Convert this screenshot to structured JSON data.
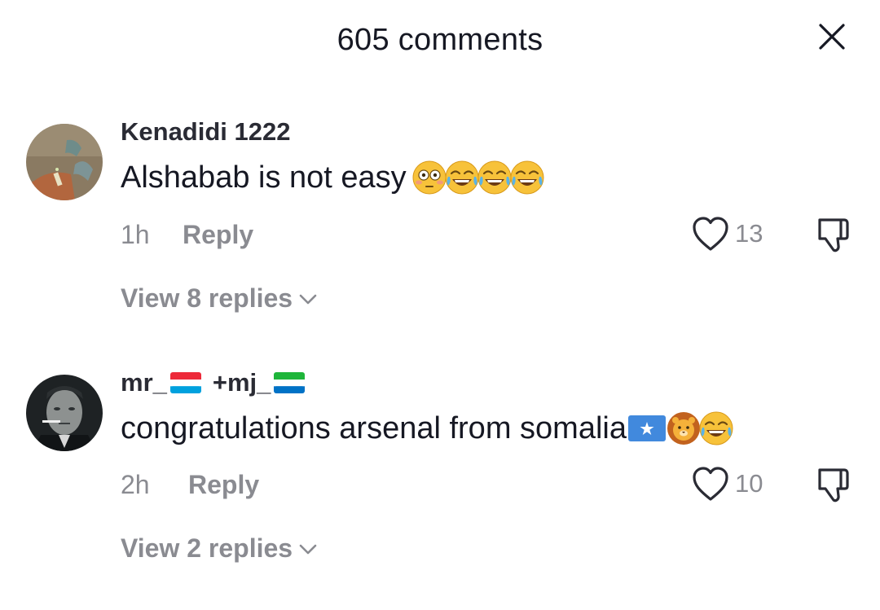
{
  "header": {
    "title": "605 comments",
    "close_icon": "close-icon"
  },
  "comments": [
    {
      "username": "Kenadidi 1222",
      "text": "Alshabab is not easy",
      "emojis": [
        "flushed-face",
        "face-with-tears-of-joy",
        "face-with-tears-of-joy",
        "face-with-tears-of-joy"
      ],
      "time": "1h",
      "reply_label": "Reply",
      "likes": "13",
      "view_replies": "View 8 replies"
    },
    {
      "username_part1": "mr_",
      "username_part2": "+mj_",
      "username_flags": [
        "luxembourg-flag",
        "sierra-leone-flag"
      ],
      "text": "congratulations arsenal from somalia",
      "emojis": [
        "somalia-flag",
        "lion-face",
        "face-with-tears-of-joy"
      ],
      "time": "2h",
      "reply_label": "Reply",
      "likes": "10",
      "view_replies": "View 2 replies"
    }
  ],
  "colors": {
    "primary_text": "#161823",
    "secondary_text": "#8a8b91",
    "background": "#ffffff"
  }
}
